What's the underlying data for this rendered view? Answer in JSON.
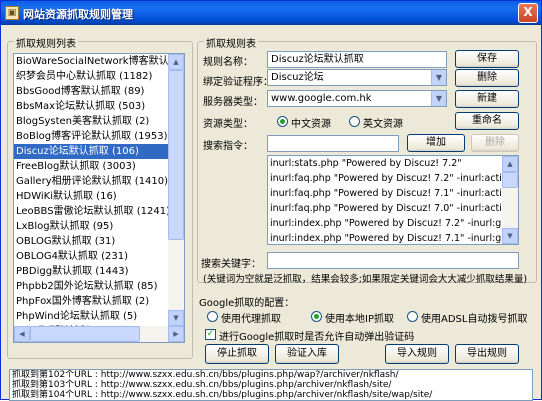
{
  "window": {
    "title": "网站资源抓取规则管理",
    "close_label": "X"
  },
  "rule_list": {
    "group_label": "抓取规则列表",
    "items": [
      "BioWareSocialNetwork博客默认抓取",
      "织梦会员中心默认抓取 (1182)",
      "BbsGood博客默认抓取 (89)",
      "BbsMax论坛默认抓取 (503)",
      "BlogSysten美客默认抓取 (2)",
      "BoBlog博客评论默认抓取 (1953)",
      "Discuz论坛默认抓取 (106)",
      "FreeBlog默认抓取 (3003)",
      "Gallery相册评论默认抓取 (1410)",
      "HDWiKi默认抓取 (16)",
      "LeoBBS雷傲论坛默认抓取 (1241)",
      "LxBlog默认抓取 (95)",
      "OBLOG默认抓取 (31)",
      "OBLOG4默认抓取 (231)",
      "PBDigg默认抓取 (1443)",
      "Phpbb2国外论坛默认抓取 (85)",
      "PhpFox国外博客默认抓取 (2)",
      "PhpWind论坛默认抓取 (5)",
      "Php吧吧默认抓取 (127)",
      "Qjblog博客默认抓取 (9)"
    ],
    "selected_index": 6
  },
  "rule_detail": {
    "group_label": "抓取规则表",
    "rule_name_label": "规则名称：",
    "rule_name_value": "Discuz论坛默认抓取",
    "bind_program_label": "绑定验证程序：",
    "bind_program_value": "Discuz论坛",
    "server_type_label": "服务器类型：",
    "server_type_value": "www.google.com.hk",
    "resource_type_label": "资源类型：",
    "radio_cn": "中文资源",
    "radio_en": "英文资源",
    "search_cmd_label": "搜索指令：",
    "search_cmd_value": "",
    "search_commands": [
      "inurl:stats.php \"Powered by Discuz! 7.2\"",
      "inurl:faq.php \"Powered by Discuz! 7.2\" -inurl:action",
      "inurl:faq.php \"Powered by Discuz! 7.1\" -inurl:action",
      "inurl:faq.php \"Powered by Discuz! 7.0\" -inurl:action",
      "inurl:index.php \"Powered by Discuz! 7.2\" -inurl:gid",
      "inurl:index.php \"Powered by Discuz! 7.1\" -inurl:gid"
    ],
    "keyword_label": "搜索关键字：",
    "keyword_value": "",
    "hint": "(关键词为空就是泛抓取，结果会较多;如果限定关键词会大大减少抓取结果量)"
  },
  "buttons": {
    "save": "保存",
    "delete": "删除",
    "new": "新建",
    "rename": "重命名",
    "add": "增加",
    "remove": "删除"
  },
  "google_config": {
    "label": "Google抓取的配置：",
    "option_proxy": "使用代理抓取",
    "option_local_ip": "使用本地IP抓取",
    "option_adsl": "使用ADSL自动拨号抓取",
    "checkbox_label": "进行Google抓取时是否允许自动弹出验证码"
  },
  "actions": {
    "stop": "停止抓取",
    "verify": "验证入库",
    "import": "导入规则",
    "export": "导出规则"
  },
  "log_lines": [
    "抓取到第102个URL : http://www.szxx.edu.sh.cn/bbs/plugins.php/wap?/archiver/nkflash/",
    "抓取到第103个URL : http://www.szxx.edu.sh.cn/bbs/plugins.php/archiver/nkflash/site/",
    "抓取到第104个URL : http://www.szxx.edu.sh.cn/bbs/plugins.php/archiver/nkflash/site/wap/site/"
  ]
}
